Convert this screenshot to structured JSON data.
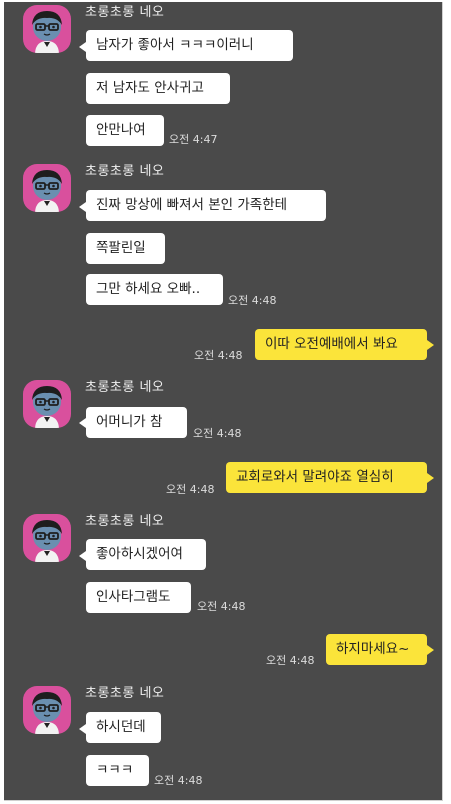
{
  "sender": {
    "name": "초롱초롱 네오",
    "avatar_icon": "neo-avatar-icon",
    "avatar_color": "#d9509d"
  },
  "colors": {
    "background": "#4a4a4a",
    "incoming_bubble": "#ffffff",
    "outgoing_bubble": "#fbe43a"
  },
  "groups": [
    {
      "sender": "초롱초롱 네오",
      "messages": [
        "남자가 좋아서 ㅋㅋㅋ이러니",
        "저 남자도 안사귀고",
        "안만나여"
      ],
      "time": "오전 4:47"
    },
    {
      "sender": "초롱초롱 네오",
      "messages": [
        "진짜 망상에 빠져서 본인 가족한테",
        "쪽팔린일",
        "그만 하세요 오빠.."
      ],
      "time": "오전 4:48"
    },
    {
      "outgoing": true,
      "messages": [
        "이따 오전예배에서 봐요"
      ],
      "time": "오전 4:48"
    },
    {
      "sender": "초롱초롱 네오",
      "messages": [
        "어머니가 참"
      ],
      "time": "오전 4:48"
    },
    {
      "outgoing": true,
      "messages": [
        "교회로와서 말려야죠 열심히"
      ],
      "time": "오전 4:48"
    },
    {
      "sender": "초롱초롱 네오",
      "messages": [
        "좋아하시겠어여",
        "인사타그램도"
      ],
      "time": "오전 4:48"
    },
    {
      "outgoing": true,
      "messages": [
        "하지마세요~"
      ],
      "time": "오전 4:48"
    },
    {
      "sender": "초롱초롱 네오",
      "messages": [
        "하시던데",
        "ㅋㅋㅋ"
      ],
      "time": "오전 4:48"
    }
  ]
}
